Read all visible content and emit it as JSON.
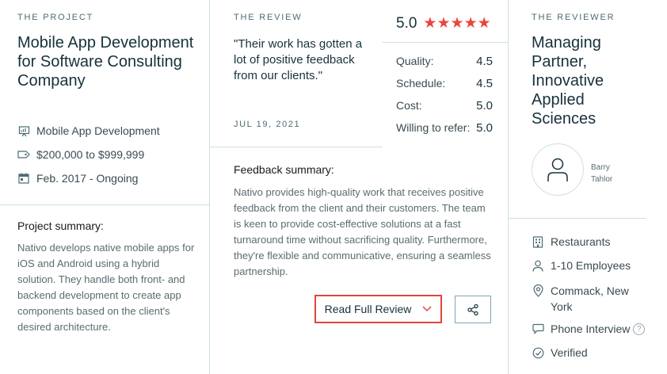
{
  "project": {
    "eyebrow": "THE PROJECT",
    "title": "Mobile App Development for Software Consulting Company",
    "service": "Mobile App Development",
    "budget": "$200,000 to $999,999",
    "timeline": "Feb. 2017 - Ongoing",
    "summary_heading": "Project summary:",
    "summary": "Nativo develops native mobile apps for iOS and Android using a hybrid solution. They handle both front- and backend development to create app components based on the client's desired architecture."
  },
  "review": {
    "eyebrow": "THE REVIEW",
    "quote": "\"Their work has gotten a lot of positive feedback from our clients.\"",
    "date": "JUL 19, 2021",
    "overall": "5.0",
    "stars": 5,
    "scores": [
      {
        "label": "Quality:",
        "value": "4.5"
      },
      {
        "label": "Schedule:",
        "value": "4.5"
      },
      {
        "label": "Cost:",
        "value": "5.0"
      },
      {
        "label": "Willing to refer:",
        "value": "5.0"
      }
    ],
    "feedback_heading": "Feedback summary:",
    "feedback": "Nativo provides high-quality work that receives positive feedback from the client and their customers. The team is keen to provide cost-effective solutions at a fast turnaround time without sacrificing quality. Furthermore, they're flexible and communicative, ensuring a seamless partnership.",
    "read_button": "Read Full Review"
  },
  "reviewer": {
    "eyebrow": "THE REVIEWER",
    "title": "Managing Partner, Innovative Applied Sciences",
    "first_name": "Barry",
    "last_name": "Tahlor",
    "industry": "Restaurants",
    "employees": "1-10 Employees",
    "location": "Commack, New York",
    "review_type": "Phone Interview",
    "help_glyph": "?",
    "status": "Verified"
  },
  "colors": {
    "accent": "#e8473c",
    "divider": "#cfe0e4",
    "share_border": "#7fa7b1"
  }
}
